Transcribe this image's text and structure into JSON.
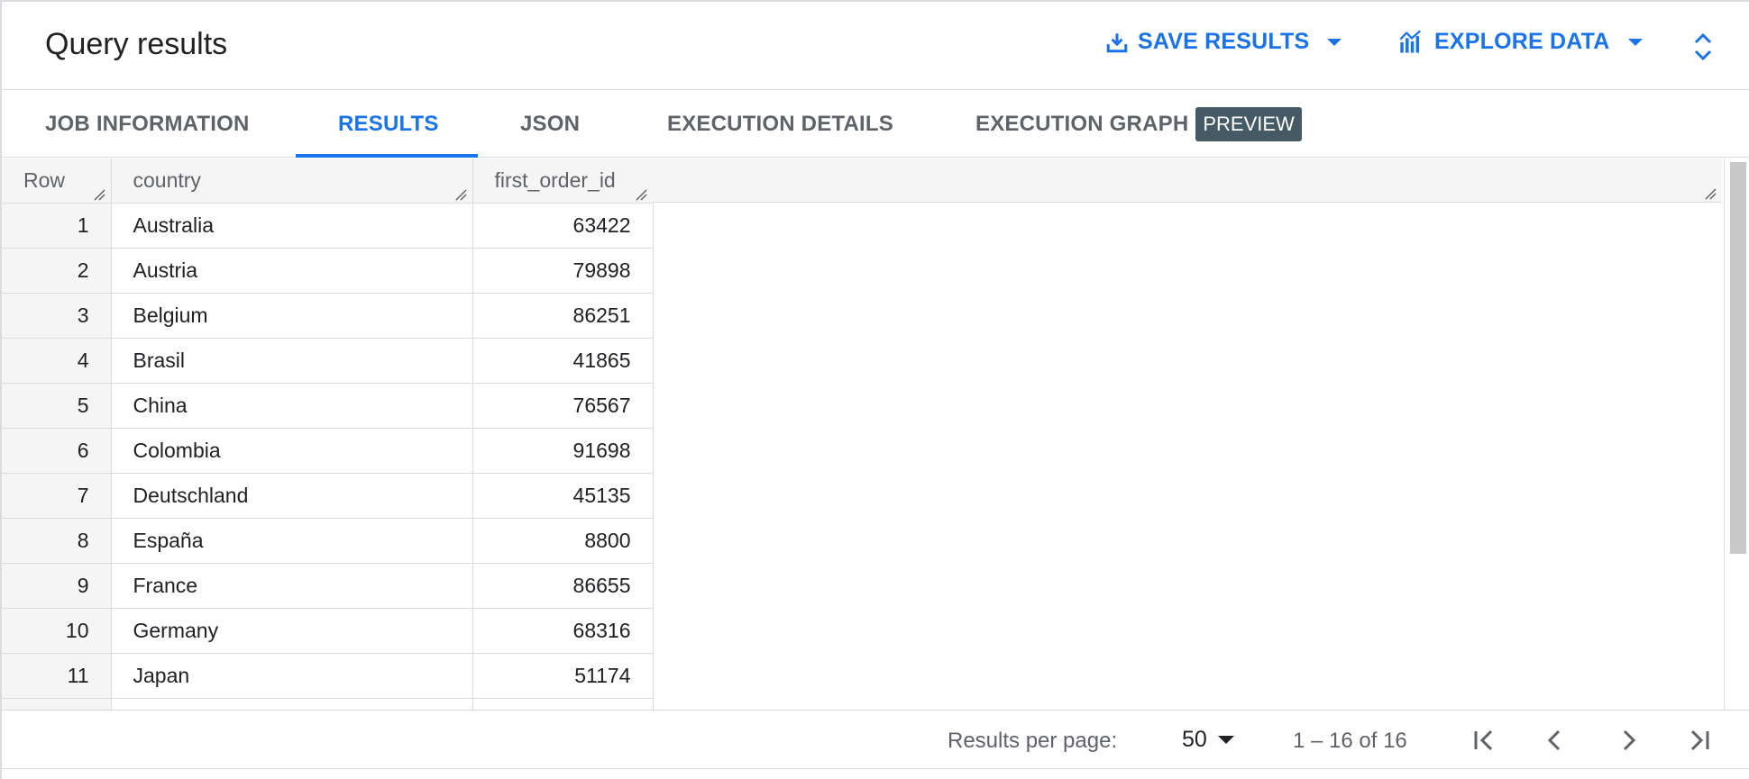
{
  "header": {
    "title": "Query results",
    "save_label": "SAVE RESULTS",
    "explore_label": "EXPLORE DATA"
  },
  "tabs": [
    {
      "label": "JOB INFORMATION"
    },
    {
      "label": "RESULTS"
    },
    {
      "label": "JSON"
    },
    {
      "label": "EXECUTION DETAILS"
    },
    {
      "label": "EXECUTION GRAPH"
    }
  ],
  "preview_badge": "PREVIEW",
  "table": {
    "columns": [
      "Row",
      "country",
      "first_order_id"
    ],
    "rows": [
      {
        "row": "1",
        "country": "Australia",
        "first_order_id": "63422"
      },
      {
        "row": "2",
        "country": "Austria",
        "first_order_id": "79898"
      },
      {
        "row": "3",
        "country": "Belgium",
        "first_order_id": "86251"
      },
      {
        "row": "4",
        "country": "Brasil",
        "first_order_id": "41865"
      },
      {
        "row": "5",
        "country": "China",
        "first_order_id": "76567"
      },
      {
        "row": "6",
        "country": "Colombia",
        "first_order_id": "91698"
      },
      {
        "row": "7",
        "country": "Deutschland",
        "first_order_id": "45135"
      },
      {
        "row": "8",
        "country": "España",
        "first_order_id": "8800"
      },
      {
        "row": "9",
        "country": "France",
        "first_order_id": "86655"
      },
      {
        "row": "10",
        "country": "Germany",
        "first_order_id": "68316"
      },
      {
        "row": "11",
        "country": "Japan",
        "first_order_id": "51174"
      }
    ]
  },
  "footer": {
    "per_page_label": "Results per page:",
    "per_page_value": "50",
    "range_text": "1 – 16 of 16"
  },
  "colors": {
    "accent": "#1a73e8",
    "badge": "#455a64"
  }
}
